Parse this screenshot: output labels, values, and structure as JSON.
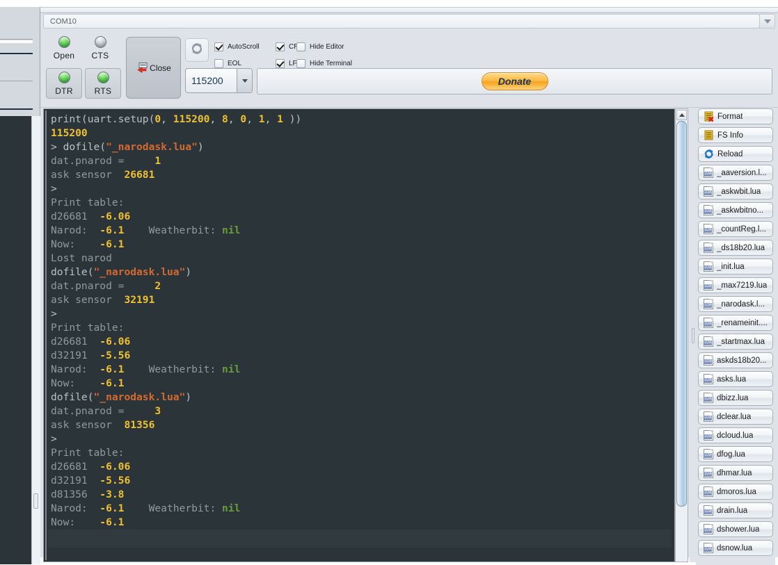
{
  "window": {
    "port_title": "COM10",
    "port_dropdown_icon": "chevron-down-icon"
  },
  "toolbar": {
    "leds": [
      {
        "name": "Open",
        "state": "on",
        "color": "#5ad44f"
      },
      {
        "name": "CTS",
        "state": "off",
        "color": "#c8ccd0"
      }
    ],
    "led_buttons": [
      {
        "name": "DTR",
        "state": "on",
        "color": "#5ad44f"
      },
      {
        "name": "RTS",
        "state": "on",
        "color": "#5ad44f"
      }
    ],
    "close_button": {
      "label": "Close",
      "icon": "close-port-icon"
    },
    "refresh_button": {
      "icon": "refresh-icon"
    },
    "checkboxes": [
      {
        "label": "AutoScroll",
        "checked": true
      },
      {
        "label": "EOL",
        "checked": false
      },
      {
        "label": "CR",
        "checked": true
      },
      {
        "label": "LF",
        "checked": true
      },
      {
        "label": "Hide Editor",
        "checked": false
      },
      {
        "label": "Hide Terminal",
        "checked": false
      }
    ],
    "baud": {
      "value": "115200",
      "icon": "chevron-down-icon"
    },
    "donate": {
      "label": "Donate",
      "color": "#f5a21b",
      "text_color": "#18335e"
    }
  },
  "terminal": {
    "colors": {
      "background": "#2b3438",
      "plain": "#8e9ba0",
      "number": "#f0c131",
      "string": "#d46a32",
      "keyword": "#6b9b3f"
    },
    "lines": [
      {
        "segments": [
          {
            "t": "print(uart.setup(",
            "c": "w"
          },
          {
            "t": "0",
            "c": "y"
          },
          {
            "t": ", ",
            "c": "w"
          },
          {
            "t": "115200",
            "c": "y"
          },
          {
            "t": ", ",
            "c": "w"
          },
          {
            "t": "8",
            "c": "y"
          },
          {
            "t": ", ",
            "c": "w"
          },
          {
            "t": "0",
            "c": "y"
          },
          {
            "t": ", ",
            "c": "w"
          },
          {
            "t": "1",
            "c": "y"
          },
          {
            "t": ", ",
            "c": "w"
          },
          {
            "t": "1",
            "c": "y"
          },
          {
            "t": " ))",
            "c": "w"
          }
        ]
      },
      {
        "segments": [
          {
            "t": "115200",
            "c": "y"
          }
        ]
      },
      {
        "segments": [
          {
            "t": "> ",
            "c": "w"
          },
          {
            "t": "dofile(",
            "c": "w"
          },
          {
            "t": "\"_narodask.lua\"",
            "c": "o"
          },
          {
            "t": ")",
            "c": "w"
          }
        ]
      },
      {
        "segments": [
          {
            "t": "dat.pnarod =     ",
            "c": "g"
          },
          {
            "t": "1",
            "c": "y"
          }
        ]
      },
      {
        "segments": [
          {
            "t": "ask sensor  ",
            "c": "g"
          },
          {
            "t": "26681",
            "c": "y"
          }
        ]
      },
      {
        "segments": [
          {
            "t": ">",
            "c": "w"
          }
        ]
      },
      {
        "segments": [
          {
            "t": "Print table:",
            "c": "g"
          }
        ]
      },
      {
        "segments": [
          {
            "t": "d26681  ",
            "c": "g"
          },
          {
            "t": "-6.06",
            "c": "y"
          }
        ]
      },
      {
        "segments": [
          {
            "t": "Narod:  ",
            "c": "g"
          },
          {
            "t": "-6.1",
            "c": "y"
          },
          {
            "t": "    Weatherbit: ",
            "c": "g"
          },
          {
            "t": "nil",
            "c": "gr"
          }
        ]
      },
      {
        "segments": [
          {
            "t": "Now:    ",
            "c": "g"
          },
          {
            "t": "-6.1",
            "c": "y"
          }
        ]
      },
      {
        "segments": [
          {
            "t": "Lost narod",
            "c": "g"
          }
        ]
      },
      {
        "segments": [
          {
            "t": "dofile(",
            "c": "w"
          },
          {
            "t": "\"_narodask.lua\"",
            "c": "o"
          },
          {
            "t": ")",
            "c": "w"
          }
        ]
      },
      {
        "segments": [
          {
            "t": "dat.pnarod =     ",
            "c": "g"
          },
          {
            "t": "2",
            "c": "y"
          }
        ]
      },
      {
        "segments": [
          {
            "t": "ask sensor  ",
            "c": "g"
          },
          {
            "t": "32191",
            "c": "y"
          }
        ]
      },
      {
        "segments": [
          {
            "t": ">",
            "c": "w"
          }
        ]
      },
      {
        "segments": [
          {
            "t": "Print table:",
            "c": "g"
          }
        ]
      },
      {
        "segments": [
          {
            "t": "d26681  ",
            "c": "g"
          },
          {
            "t": "-6.06",
            "c": "y"
          }
        ]
      },
      {
        "segments": [
          {
            "t": "d32191  ",
            "c": "g"
          },
          {
            "t": "-5.56",
            "c": "y"
          }
        ]
      },
      {
        "segments": [
          {
            "t": "Narod:  ",
            "c": "g"
          },
          {
            "t": "-6.1",
            "c": "y"
          },
          {
            "t": "    Weatherbit: ",
            "c": "g"
          },
          {
            "t": "nil",
            "c": "gr"
          }
        ]
      },
      {
        "segments": [
          {
            "t": "Now:    ",
            "c": "g"
          },
          {
            "t": "-6.1",
            "c": "y"
          }
        ]
      },
      {
        "segments": [
          {
            "t": "dofile(",
            "c": "w"
          },
          {
            "t": "\"_narodask.lua\"",
            "c": "o"
          },
          {
            "t": ")",
            "c": "w"
          }
        ]
      },
      {
        "segments": [
          {
            "t": "dat.pnarod =     ",
            "c": "g"
          },
          {
            "t": "3",
            "c": "y"
          }
        ]
      },
      {
        "segments": [
          {
            "t": "ask sensor  ",
            "c": "g"
          },
          {
            "t": "81356",
            "c": "y"
          }
        ]
      },
      {
        "segments": [
          {
            "t": ">",
            "c": "w"
          }
        ]
      },
      {
        "segments": [
          {
            "t": "Print table:",
            "c": "g"
          }
        ]
      },
      {
        "segments": [
          {
            "t": "d26681  ",
            "c": "g"
          },
          {
            "t": "-6.06",
            "c": "y"
          }
        ]
      },
      {
        "segments": [
          {
            "t": "d32191  ",
            "c": "g"
          },
          {
            "t": "-5.56",
            "c": "y"
          }
        ]
      },
      {
        "segments": [
          {
            "t": "d81356  ",
            "c": "g"
          },
          {
            "t": "-3.8",
            "c": "y"
          }
        ]
      },
      {
        "segments": [
          {
            "t": "Narod:  ",
            "c": "g"
          },
          {
            "t": "-6.1",
            "c": "y"
          },
          {
            "t": "    Weatherbit: ",
            "c": "g"
          },
          {
            "t": "nil",
            "c": "gr"
          }
        ]
      },
      {
        "segments": [
          {
            "t": "Now:    ",
            "c": "g"
          },
          {
            "t": "-6.1",
            "c": "y"
          }
        ]
      }
    ]
  },
  "sidebar": {
    "actions": [
      {
        "label": "Format",
        "icon": "format-icon"
      },
      {
        "label": "FS Info",
        "icon": "fsinfo-icon"
      },
      {
        "label": "Reload",
        "icon": "reload-icon"
      }
    ],
    "files": [
      {
        "label": "_aaversion.l...",
        "icon": "lua-file-icon"
      },
      {
        "label": "_askwbit.lua",
        "icon": "lua-file-icon"
      },
      {
        "label": "_askwbitno...",
        "icon": "lua-file-icon"
      },
      {
        "label": "_countReg.l...",
        "icon": "lua-file-icon"
      },
      {
        "label": "_ds18b20.lua",
        "icon": "lua-file-icon"
      },
      {
        "label": "_init.lua",
        "icon": "lua-file-icon"
      },
      {
        "label": "_max7219.lua",
        "icon": "lua-file-icon"
      },
      {
        "label": "_narodask.l...",
        "icon": "lua-file-icon"
      },
      {
        "label": "_renameinit....",
        "icon": "lua-file-icon"
      },
      {
        "label": "_startmax.lua",
        "icon": "lua-file-icon"
      },
      {
        "label": "askds18b20...",
        "icon": "lua-file-icon"
      },
      {
        "label": "asks.lua",
        "icon": "lua-file-icon"
      },
      {
        "label": "dbizz.lua",
        "icon": "lua-file-icon"
      },
      {
        "label": "dclear.lua",
        "icon": "lua-file-icon"
      },
      {
        "label": "dcloud.lua",
        "icon": "lua-file-icon"
      },
      {
        "label": "dfog.lua",
        "icon": "lua-file-icon"
      },
      {
        "label": "dhmar.lua",
        "icon": "lua-file-icon"
      },
      {
        "label": "dmoros.lua",
        "icon": "lua-file-icon"
      },
      {
        "label": "drain.lua",
        "icon": "lua-file-icon"
      },
      {
        "label": "dshower.lua",
        "icon": "lua-file-icon"
      },
      {
        "label": "dsnow.lua",
        "icon": "lua-file-icon"
      }
    ],
    "lua_icon_text": "LUA"
  }
}
